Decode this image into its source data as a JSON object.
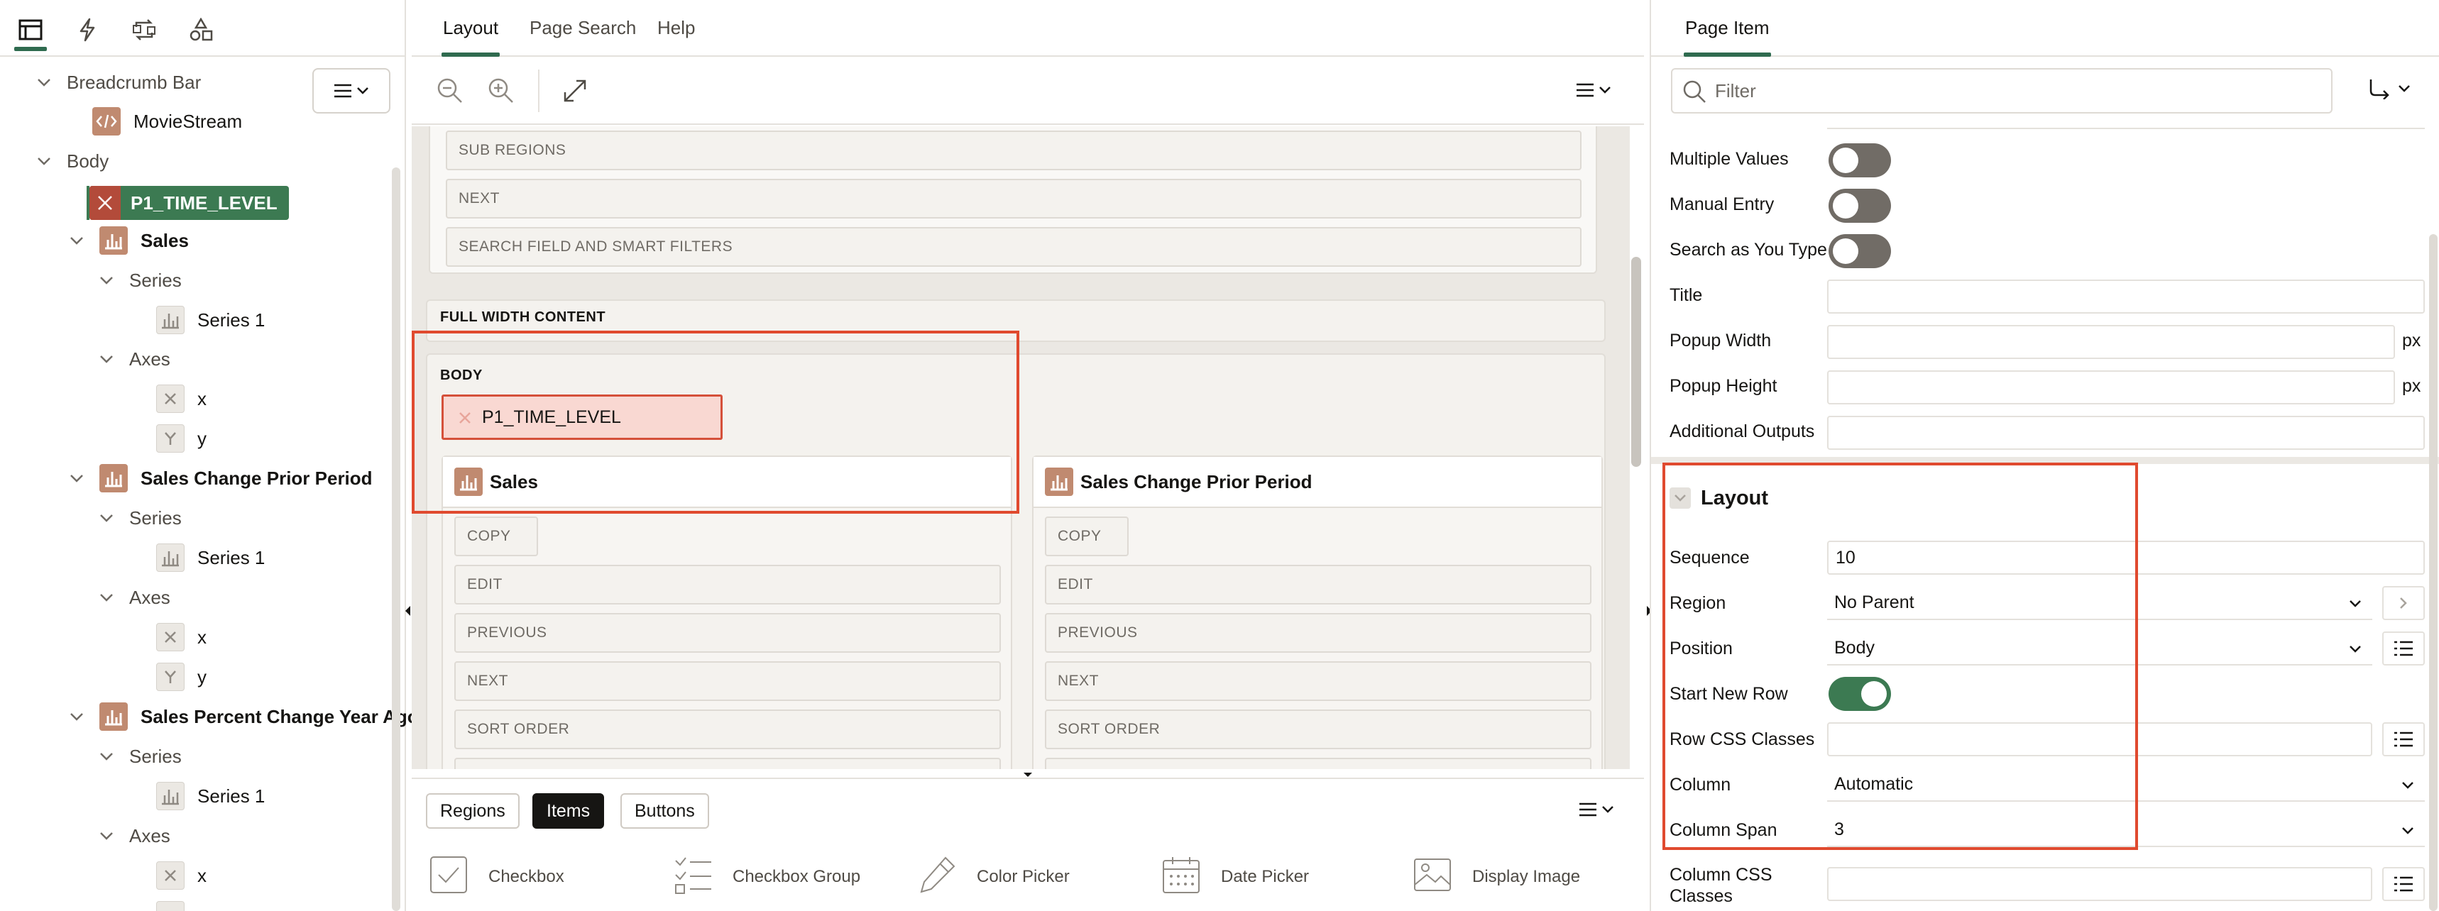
{
  "left_panel": {
    "tree": [
      {
        "id": "breadcrumb-bar",
        "label": "Breadcrumb Bar"
      },
      {
        "id": "moviestream",
        "label": "MovieStream"
      },
      {
        "id": "body",
        "label": "Body"
      },
      {
        "id": "p1-time-level",
        "label": "P1_TIME_LEVEL"
      },
      {
        "id": "sales",
        "label": "Sales"
      },
      {
        "id": "sales-series",
        "label": "Series"
      },
      {
        "id": "sales-series-1",
        "label": "Series 1"
      },
      {
        "id": "sales-axes",
        "label": "Axes"
      },
      {
        "id": "sales-axis-x",
        "label": "x"
      },
      {
        "id": "sales-axis-y",
        "label": "y"
      },
      {
        "id": "sales-change",
        "label": "Sales Change Prior Period"
      },
      {
        "id": "sales-change-series",
        "label": "Series"
      },
      {
        "id": "sales-change-series-1",
        "label": "Series 1"
      },
      {
        "id": "sales-change-axes",
        "label": "Axes"
      },
      {
        "id": "sales-change-axis-x",
        "label": "x"
      },
      {
        "id": "sales-change-axis-y",
        "label": "y"
      },
      {
        "id": "sales-pct",
        "label": "Sales Percent Change Year Ago"
      },
      {
        "id": "sales-pct-series",
        "label": "Series"
      },
      {
        "id": "sales-pct-series-1",
        "label": "Series 1"
      },
      {
        "id": "sales-pct-axes",
        "label": "Axes"
      },
      {
        "id": "sales-pct-axis-x",
        "label": "x"
      }
    ]
  },
  "center_panel": {
    "tabs": [
      "Layout",
      "Page Search",
      "Help"
    ],
    "top_slots": [
      "SUB REGIONS",
      "NEXT",
      "SEARCH FIELD AND SMART FILTERS"
    ],
    "full_width_content": "FULL WIDTH CONTENT",
    "body_label": "BODY",
    "item_label": "P1_TIME_LEVEL",
    "regions": [
      {
        "title": "Sales",
        "slots": [
          "COPY",
          "EDIT",
          "PREVIOUS",
          "NEXT",
          "SORT ORDER"
        ]
      },
      {
        "title": "Sales Change Prior Period",
        "slots": [
          "COPY",
          "EDIT",
          "PREVIOUS",
          "NEXT",
          "SORT ORDER"
        ]
      }
    ],
    "palette_tabs": [
      "Regions",
      "Items",
      "Buttons"
    ],
    "palette_items": [
      "Checkbox",
      "Checkbox Group",
      "Color Picker",
      "Date Picker",
      "Display Image"
    ]
  },
  "right_panel": {
    "tab": "Page Item",
    "filter_placeholder": "Filter",
    "toggles": [
      {
        "label": "Multiple Values",
        "on": false
      },
      {
        "label": "Manual Entry",
        "on": false
      },
      {
        "label": "Search as You Type",
        "on": false
      }
    ],
    "title_label": "Title",
    "popup_width_label": "Popup Width",
    "popup_height_label": "Popup Height",
    "px_unit": "px",
    "additional_outputs_label": "Additional Outputs",
    "layout_group": "Layout",
    "layout": {
      "sequence": {
        "label": "Sequence",
        "value": "10"
      },
      "region": {
        "label": "Region",
        "value": "No Parent"
      },
      "position": {
        "label": "Position",
        "value": "Body"
      },
      "start_new_row": {
        "label": "Start New Row",
        "on": true
      },
      "row_css_classes": {
        "label": "Row CSS Classes",
        "value": ""
      },
      "column": {
        "label": "Column",
        "value": "Automatic"
      },
      "column_span": {
        "label": "Column Span",
        "value": "3"
      },
      "column_css_classes": {
        "label": "Column CSS Classes",
        "value": ""
      }
    },
    "colors": {
      "accent": "#2f6b4f",
      "toggle_on": "#3c7a52",
      "highlight": "#e04a2f",
      "badge": "#c08a70"
    }
  }
}
